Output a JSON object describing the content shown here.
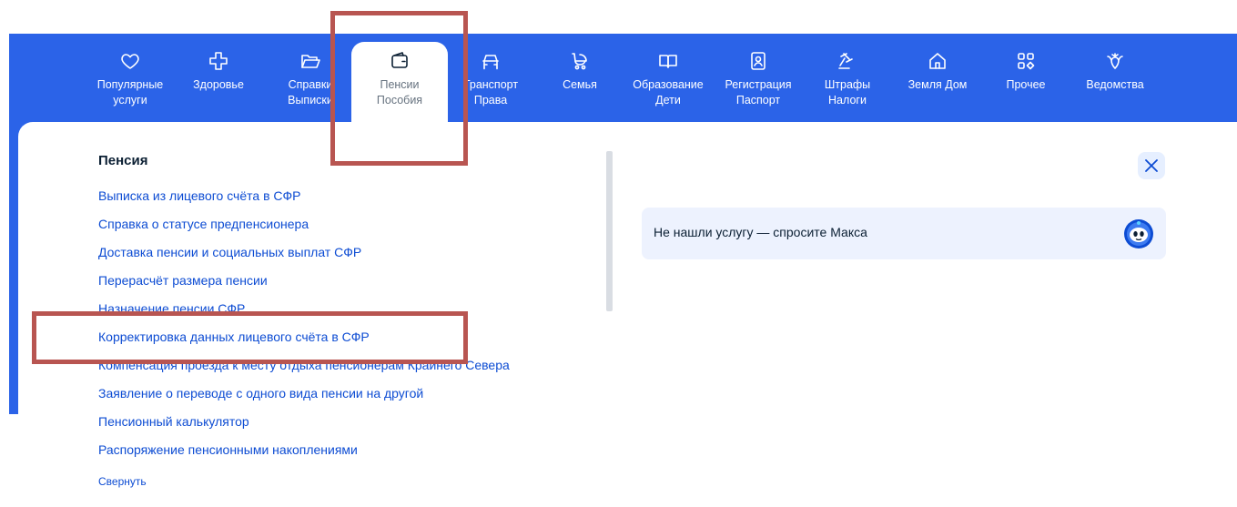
{
  "nav": {
    "items": [
      {
        "line1": "Популярные",
        "line2": "услуги",
        "icon": "heart-icon"
      },
      {
        "line1": "Здоровье",
        "line2": "",
        "icon": "medical-cross-icon"
      },
      {
        "line1": "Справки",
        "line2": "Выписки",
        "icon": "folder-icon"
      },
      {
        "line1": "Пенсии",
        "line2": "Пособия",
        "icon": "wallet-icon",
        "active": true
      },
      {
        "line1": "Транспорт",
        "line2": "Права",
        "icon": "car-icon"
      },
      {
        "line1": "Семья",
        "line2": "",
        "icon": "stroller-icon"
      },
      {
        "line1": "Образование",
        "line2": "Дети",
        "icon": "book-icon"
      },
      {
        "line1": "Регистрация",
        "line2": "Паспорт",
        "icon": "id-card-icon"
      },
      {
        "line1": "Штрафы",
        "line2": "Налоги",
        "icon": "gavel-icon"
      },
      {
        "line1": "Земля Дом",
        "line2": "",
        "icon": "house-icon"
      },
      {
        "line1": "Прочее",
        "line2": "",
        "icon": "grid-icon"
      },
      {
        "line1": "Ведомства",
        "line2": "",
        "icon": "emblem-icon"
      }
    ]
  },
  "menu": {
    "section_title": "Пенсия",
    "links": [
      "Выписка из лицевого счёта в СФР",
      "Справка о статусе предпенсионера",
      "Доставка пенсии и социальных выплат СФР",
      "Перерасчёт размера пенсии",
      "Назначение пенсии СФР",
      "Корректировка данных лицевого счёта в СФР",
      "Компенсация проезда к месту отдыха пенсионерам Крайнего Севера",
      "Заявление о переводе с одного вида пенсии на другой",
      "Пенсионный калькулятор",
      "Распоряжение пенсионными накоплениями"
    ],
    "collapse_label": "Свернуть"
  },
  "assistant": {
    "ask_text": "Не нашли услугу — спросите Макса",
    "avatar_icon": "robot-avatar-icon"
  },
  "close_icon": "close-icon",
  "colors": {
    "brand_blue": "#2b63e8",
    "link": "#0d4cd3",
    "highlight": "#b85551",
    "ask_background": "#edf2fe"
  }
}
